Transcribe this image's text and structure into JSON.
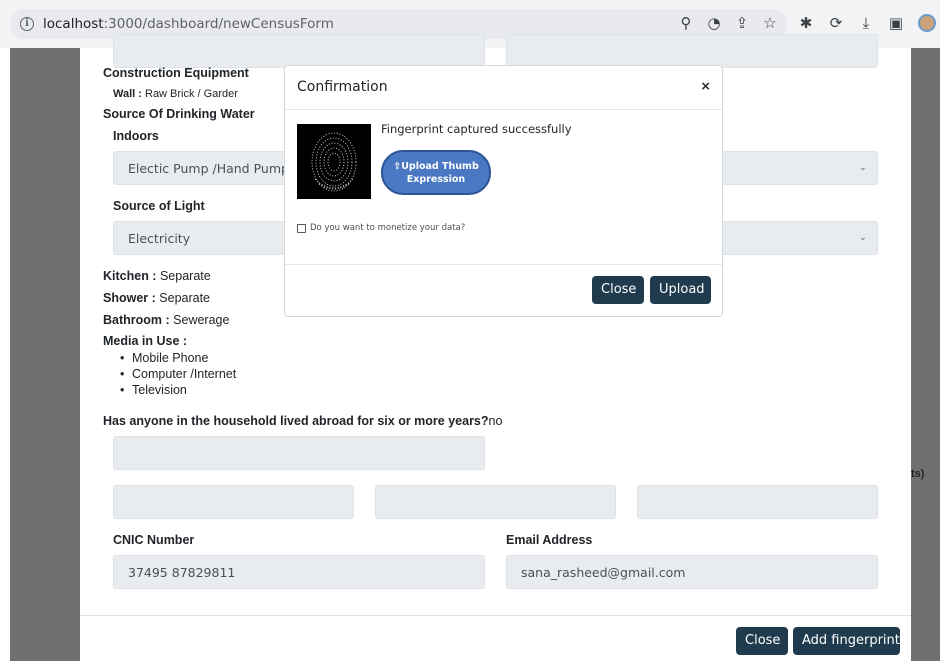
{
  "browser": {
    "url_host": "localhost",
    "url_path": ":3000/dashboard/newCensusForm"
  },
  "form": {
    "construction_title": "Construction Equipment",
    "wall_label": "Wall :",
    "wall_value": "Raw Brick / Garder",
    "drinking_water_title": "Source Of Drinking Water",
    "indoors_label": "Indoors",
    "indoors_value": "Electic Pump /Hand Pump",
    "light_label": "Source of Light",
    "light_value": "Electricity",
    "kitchen_label": "Kitchen :",
    "kitchen_value": "Separate",
    "shower_label": "Shower :",
    "shower_value": "Separate",
    "bathroom_label": "Bathroom :",
    "bathroom_value": "Sewerage",
    "media_label": "Media in Use :",
    "media_items": [
      "Mobile Phone",
      "Computer /Internet",
      "Television"
    ],
    "abroad_question": "Has anyone in the household lived abroad for six or more years?",
    "abroad_answer": "no",
    "cnic_label": "CNIC Number",
    "cnic_value": "37495 87829811",
    "email_label": "Email Address",
    "email_value": "sana_rasheed@gmail.com",
    "edge_text": "ts)"
  },
  "footer": {
    "close_label": "Close",
    "fingerprint_label": "Add fingerprint"
  },
  "modal": {
    "title": "Confirmation",
    "close_icon": "×",
    "message": "Fingerprint captured successfully",
    "upload_label_line1": "Upload Thumb",
    "upload_label_line2": "Expression",
    "monetize_label": "Do you want to monetize your data?",
    "close_button": "Close",
    "upload_button": "Upload"
  }
}
